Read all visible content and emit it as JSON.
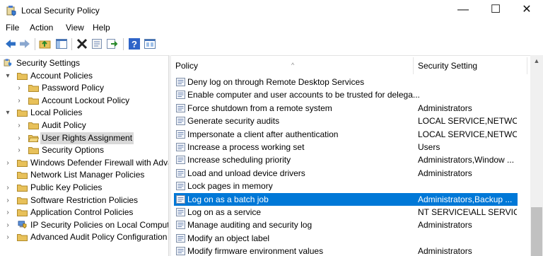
{
  "window": {
    "title": "Local Security Policy",
    "minimize": "—",
    "maximize": "☐",
    "close": "✕"
  },
  "menu": [
    "File",
    "Action",
    "View",
    "Help"
  ],
  "toolbar": [
    "back-arrow-icon",
    "forward-arrow-icon",
    "up-folder-icon",
    "show-hide-tree-icon",
    "delete-icon",
    "properties-icon",
    "export-list-icon",
    "help-icon",
    "console-icon"
  ],
  "tree": [
    {
      "label": "Security Settings",
      "level": 0,
      "expander": "",
      "icon": "security-settings-icon"
    },
    {
      "label": "Account Policies",
      "level": 1,
      "expander": "▾",
      "icon": "folder-icon"
    },
    {
      "label": "Password Policy",
      "level": 2,
      "expander": "›",
      "icon": "folder-icon"
    },
    {
      "label": "Account Lockout Policy",
      "level": 2,
      "expander": "›",
      "icon": "folder-icon"
    },
    {
      "label": "Local Policies",
      "level": 1,
      "expander": "▾",
      "icon": "folder-icon"
    },
    {
      "label": "Audit Policy",
      "level": 2,
      "expander": "›",
      "icon": "folder-icon"
    },
    {
      "label": "User Rights Assignment",
      "level": 2,
      "expander": "›",
      "icon": "folder-open-icon",
      "selected": true
    },
    {
      "label": "Security Options",
      "level": 2,
      "expander": "›",
      "icon": "folder-icon"
    },
    {
      "label": "Windows Defender Firewall with Adva",
      "level": 1,
      "expander": "›",
      "icon": "folder-icon"
    },
    {
      "label": "Network List Manager Policies",
      "level": 1,
      "expander": "",
      "icon": "folder-icon"
    },
    {
      "label": "Public Key Policies",
      "level": 1,
      "expander": "›",
      "icon": "folder-icon"
    },
    {
      "label": "Software Restriction Policies",
      "level": 1,
      "expander": "›",
      "icon": "folder-icon"
    },
    {
      "label": "Application Control Policies",
      "level": 1,
      "expander": "›",
      "icon": "folder-icon"
    },
    {
      "label": "IP Security Policies on Local Compute",
      "level": 1,
      "expander": "›",
      "icon": "ip-security-icon"
    },
    {
      "label": "Advanced Audit Policy Configuration",
      "level": 1,
      "expander": "›",
      "icon": "folder-icon"
    }
  ],
  "list": {
    "columns": {
      "policy": "Policy",
      "setting": "Security Setting",
      "sort": "^"
    },
    "rows": [
      {
        "policy": "Deny log on through Remote Desktop Services",
        "setting": ""
      },
      {
        "policy": "Enable computer and user accounts to be trusted for delega...",
        "setting": ""
      },
      {
        "policy": "Force shutdown from a remote system",
        "setting": "Administrators"
      },
      {
        "policy": "Generate security audits",
        "setting": "LOCAL SERVICE,NETWO..."
      },
      {
        "policy": "Impersonate a client after authentication",
        "setting": "LOCAL SERVICE,NETWO..."
      },
      {
        "policy": "Increase a process working set",
        "setting": "Users"
      },
      {
        "policy": "Increase scheduling priority",
        "setting": "Administrators,Window ..."
      },
      {
        "policy": "Load and unload device drivers",
        "setting": "Administrators"
      },
      {
        "policy": "Lock pages in memory",
        "setting": ""
      },
      {
        "policy": "Log on as a batch job",
        "setting": "Administrators,Backup ...",
        "selected": true
      },
      {
        "policy": "Log on as a service",
        "setting": "NT SERVICE\\ALL SERVICES"
      },
      {
        "policy": "Manage auditing and security log",
        "setting": "Administrators"
      },
      {
        "policy": "Modify an object label",
        "setting": ""
      },
      {
        "policy": "Modify firmware environment values",
        "setting": "Administrators"
      }
    ]
  },
  "scrollbar": {
    "up": "▲"
  },
  "colors": {
    "selection": "#0078d7",
    "tree_selection": "#d9d9d9",
    "folder": "#e8c15a"
  }
}
